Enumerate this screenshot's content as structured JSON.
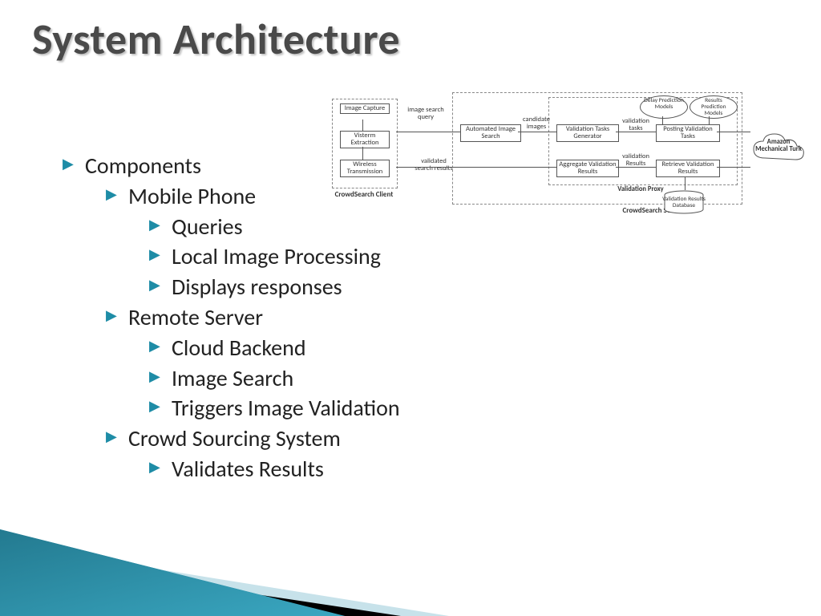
{
  "title": "System Architecture",
  "outline": {
    "l1": "Components",
    "mobile": {
      "label": "Mobile Phone",
      "items": [
        "Queries",
        "Local Image Processing",
        "Displays responses"
      ]
    },
    "server": {
      "label": "Remote Server",
      "items": [
        "Cloud Backend",
        "Image Search",
        "Triggers Image Validation"
      ]
    },
    "crowd": {
      "label": "Crowd Sourcing System",
      "items": [
        "Validates Results"
      ]
    }
  },
  "diagram": {
    "client_group": "CrowdSearch Client",
    "server_group": "CrowdSearch Server",
    "proxy_group": "Validation Proxy",
    "client_boxes": {
      "capture": "Image Capture",
      "visterm": "Visterm Extraction",
      "wireless": "Wireless Transmission"
    },
    "server_boxes": {
      "auto_search": "Automated Image Search",
      "task_gen": "Validation Tasks Generator",
      "posting": "Posting Validation Tasks",
      "delay_model": "Delay Prediction Models",
      "results_model": "Results Prediction Models",
      "aggregate": "Aggregate Validation Results",
      "retrieve": "Retrieve Validation Results",
      "db": "Validation Results Database"
    },
    "edge_labels": {
      "query": "image search query",
      "candidates": "candidate images",
      "val_tasks": "validation tasks",
      "val_results": "validation Results",
      "validated": "validated search results"
    },
    "cloud": "Amazon Mechanical Turk"
  }
}
